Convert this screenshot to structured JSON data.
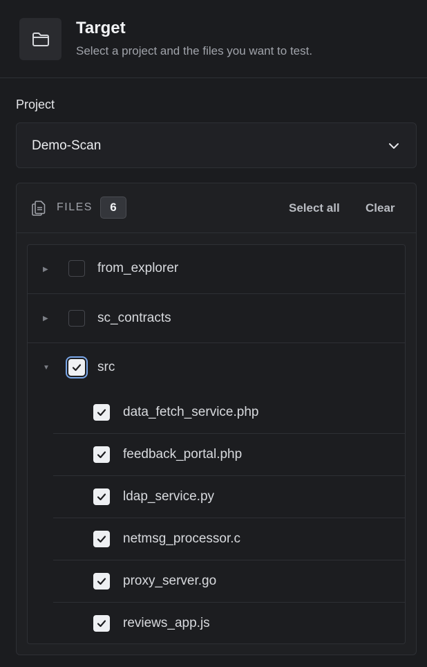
{
  "header": {
    "icon": "folder-icon",
    "title": "Target",
    "subtitle": "Select a project and the files you want to test."
  },
  "project": {
    "label": "Project",
    "selected": "Demo-Scan",
    "chevron_icon": "chevron-down-icon"
  },
  "files": {
    "icon": "files-icon",
    "label": "FILES",
    "count": "6",
    "select_all": "Select all",
    "clear": "Clear"
  },
  "tree": {
    "folders": [
      {
        "name": "from_explorer",
        "expanded": false,
        "checked": false
      },
      {
        "name": "sc_contracts",
        "expanded": false,
        "checked": false
      },
      {
        "name": "src",
        "expanded": true,
        "checked": true
      }
    ],
    "src_files": [
      {
        "name": "data_fetch_service.php",
        "checked": true
      },
      {
        "name": "feedback_portal.php",
        "checked": true
      },
      {
        "name": "ldap_service.py",
        "checked": true
      },
      {
        "name": "netmsg_processor.c",
        "checked": true
      },
      {
        "name": "proxy_server.go",
        "checked": true
      },
      {
        "name": "reviews_app.js",
        "checked": true
      }
    ]
  },
  "colors": {
    "background": "#1b1c1f",
    "panel": "#1f2023",
    "border": "#2e3035",
    "focus_ring": "#7aa7e8"
  }
}
